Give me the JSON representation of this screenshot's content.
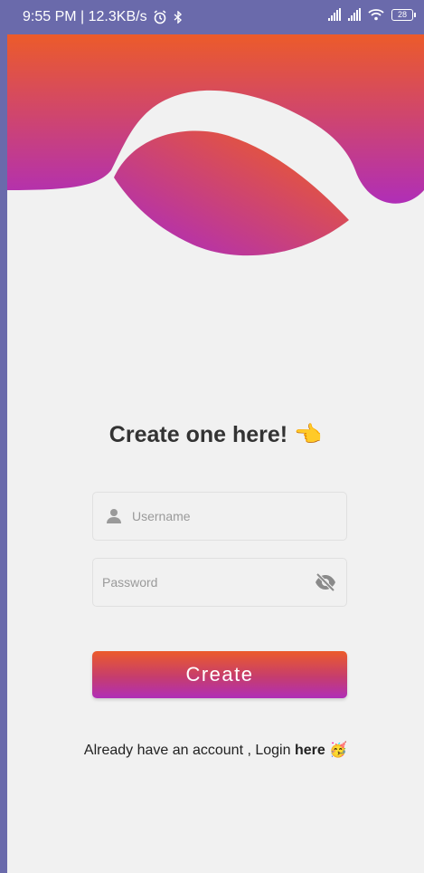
{
  "status_bar": {
    "time_speed": "9:55 PM | 12.3KB/s",
    "alarm_icon": "alarm-clock-icon",
    "battery_level": "28"
  },
  "colors": {
    "gradient_top": "#ec5b2a",
    "gradient_bottom": "#b02eb7",
    "background": "#f1f1f1",
    "status_bar": "#6a6aab"
  },
  "heading": {
    "text": "Create one here!",
    "emoji": "👈"
  },
  "form": {
    "username_placeholder": "Username",
    "password_placeholder": "Password",
    "create_label": "Create"
  },
  "footer": {
    "prefix": "Already have an account , Login ",
    "link_text": "here",
    "emoji": "🥳"
  }
}
